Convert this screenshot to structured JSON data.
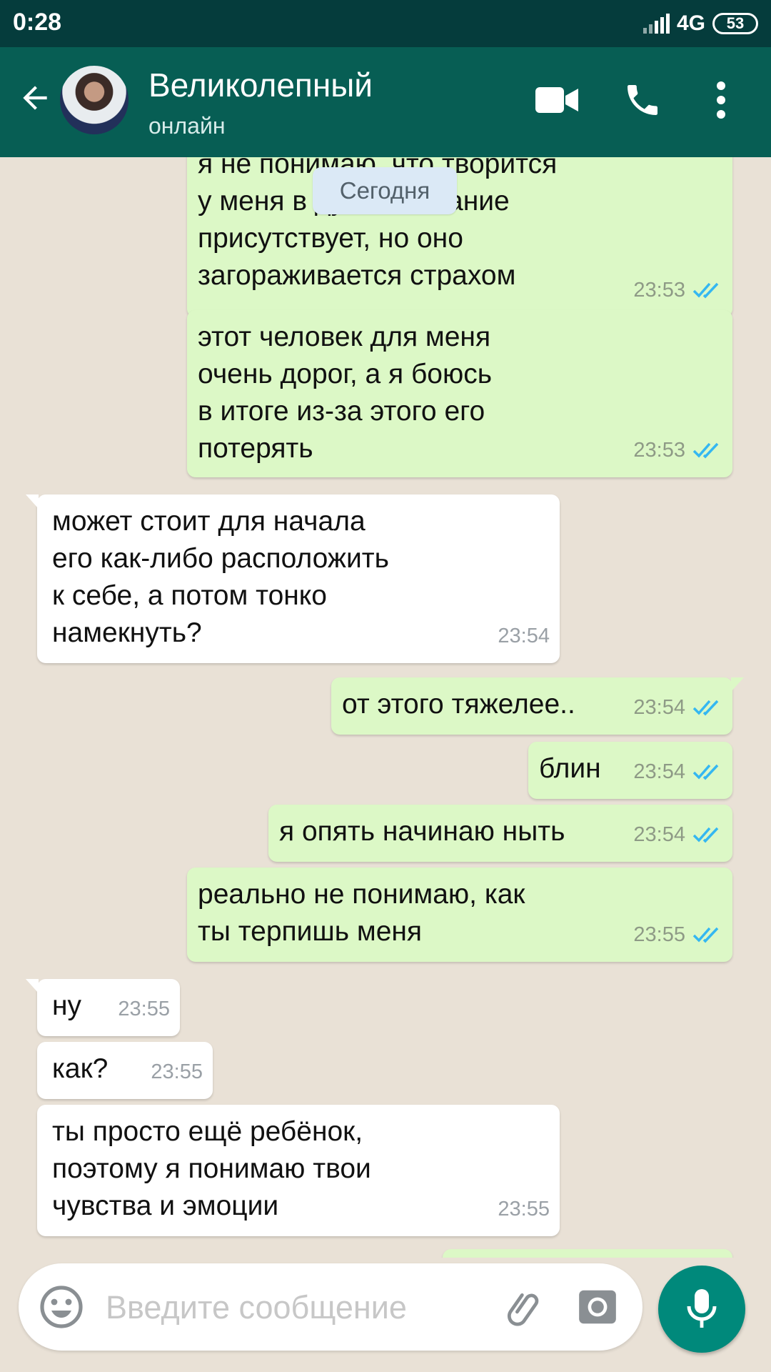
{
  "status": {
    "time": "0:28",
    "network": "4G",
    "battery": "53"
  },
  "header": {
    "back_icon": "arrow-left-icon",
    "contact_name": "Великолепный",
    "contact_status": "онлайн",
    "icons": [
      "video-call-icon",
      "phone-icon",
      "more-vert-icon"
    ]
  },
  "chat": {
    "date_label": "Сегодня",
    "messages": [
      {
        "dir": "out",
        "text": "я не понимаю, что творится\nу меня в душе. желание\nприсутствует, но оно\nзагораживается страхом",
        "time": "23:53",
        "read": true
      },
      {
        "dir": "out",
        "text": "этот человек для меня\nочень дорог, а я боюсь\nв итоге из-за этого его\nпотерять",
        "time": "23:53",
        "read": true
      },
      {
        "dir": "in",
        "text": "может стоит для начала\nего как-либо расположить\nк себе, а потом тонко\nнамекнуть?",
        "time": "23:54"
      },
      {
        "dir": "out",
        "text": "от этого тяжелее..",
        "time": "23:54",
        "read": true
      },
      {
        "dir": "out",
        "text": "блин",
        "time": "23:54",
        "read": true
      },
      {
        "dir": "out",
        "text": "я опять начинаю ныть",
        "time": "23:54",
        "read": true
      },
      {
        "dir": "out",
        "text": "реально не понимаю, как\nты терпишь меня",
        "time": "23:55",
        "read": true
      },
      {
        "dir": "in",
        "text": "ну",
        "time": "23:55"
      },
      {
        "dir": "in",
        "text": "как?",
        "time": "23:55"
      },
      {
        "dir": "in",
        "text": "ты просто ещё ребёнок,\nпоэтому я понимаю твои\nчувства и эмоции",
        "time": "23:55"
      }
    ]
  },
  "composer": {
    "placeholder": "Введите сообщение",
    "icons": [
      "emoji-icon",
      "attach-icon",
      "camera-icon",
      "mic-icon"
    ]
  },
  "colors": {
    "header": "#075e54",
    "status_bar": "#053c3c",
    "outgoing_bubble": "#dcf8c6",
    "incoming_bubble": "#ffffff",
    "read_ticks": "#34b7f1",
    "mic_button": "#00897b"
  }
}
